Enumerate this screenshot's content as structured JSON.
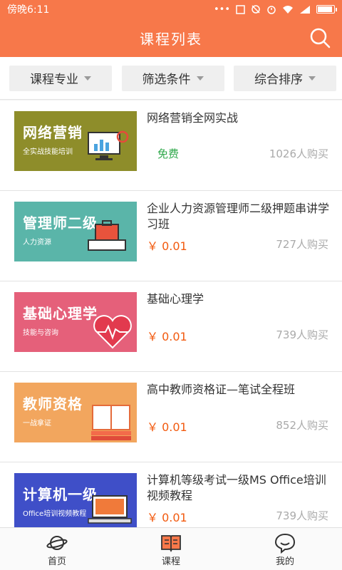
{
  "status_bar": {
    "time": "傍晚6:11",
    "icons": [
      "more-icon",
      "sim-icon",
      "alarm-off-icon",
      "alarm-icon",
      "wifi-icon",
      "signal-icon",
      "battery-icon"
    ],
    "battery_level": 0.85
  },
  "header": {
    "title": "课程列表",
    "search_icon": "search-icon"
  },
  "filters": [
    {
      "label": "课程专业"
    },
    {
      "label": "筛选条件"
    },
    {
      "label": "综合排序"
    }
  ],
  "courses": [
    {
      "thumb_main": "网络营销",
      "thumb_sub": "全实战技能培训",
      "thumb_color": "#8e8d2a",
      "title": "网络营销全网实战",
      "price": "免费",
      "free": true,
      "buyers": "1026人购买"
    },
    {
      "thumb_main": "管理师二级",
      "thumb_sub": "人力资源",
      "thumb_color": "#5ab5a9",
      "title": "企业人力资源管理师二级押题串讲学习班",
      "price": "￥ 0.01",
      "free": false,
      "buyers": "727人购买"
    },
    {
      "thumb_main": "基础心理学",
      "thumb_sub": "技能与咨询",
      "thumb_color": "#e5607a",
      "title": "基础心理学",
      "price": "￥ 0.01",
      "free": false,
      "buyers": "739人购买"
    },
    {
      "thumb_main": "教师资格",
      "thumb_sub": "一战拿证",
      "thumb_color": "#f2a65e",
      "title": "高中教师资格证—笔试全程班",
      "price": "￥ 0.01",
      "free": false,
      "buyers": "852人购买"
    },
    {
      "thumb_main": "计算机一级",
      "thumb_sub": "Office培训视频教程",
      "thumb_color": "#3f4fc8",
      "title": "计算机等级考试一级MS Office培训视频教程",
      "price": "￥ 0.01",
      "free": false,
      "buyers": "739人购买"
    }
  ],
  "bottom_nav": [
    {
      "label": "首页",
      "icon": "planet-icon"
    },
    {
      "label": "课程",
      "icon": "book-icon"
    },
    {
      "label": "我的",
      "icon": "chat-face-icon"
    }
  ],
  "colors": {
    "accent": "#f7784a",
    "price": "#f25a0f",
    "free": "#2ea84a"
  }
}
